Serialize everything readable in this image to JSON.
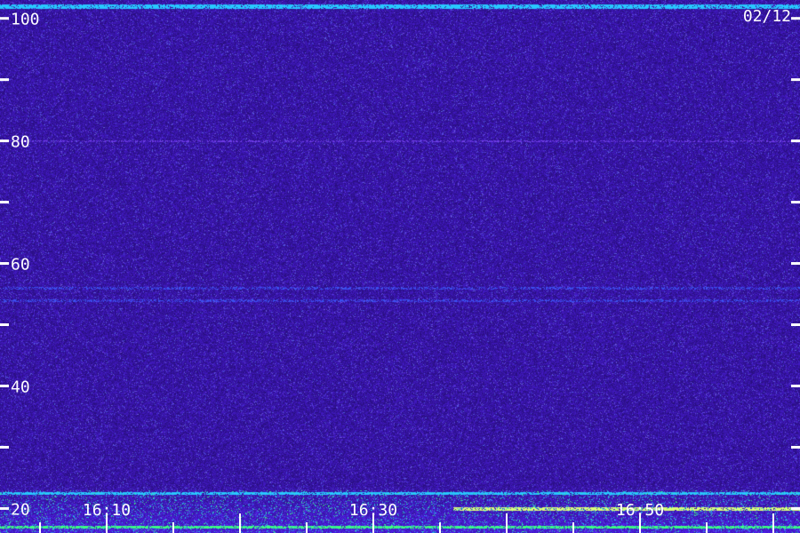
{
  "date_label": "02/12",
  "colors": {
    "background": "#1a0a5e",
    "noise_high": "#3a2ad0",
    "line_cyan": "#2ec8ff",
    "line_green": "#3cff8a",
    "line_yellow": "#e8ff7a",
    "axis": "#ffffff"
  },
  "chart_data": {
    "type": "heatmap",
    "title": "",
    "xlabel": "",
    "ylabel": "",
    "x_range": [
      "16:02",
      "17:02"
    ],
    "x_ticks": [
      "16:10",
      "16:30",
      "16:50"
    ],
    "y_range": [
      16,
      103
    ],
    "y_ticks": [
      20,
      40,
      60,
      80,
      100
    ],
    "y_minor_ticks": [
      30,
      50,
      70,
      90
    ],
    "x_minor_step_minutes": 5,
    "grid": false,
    "bands": [
      {
        "y": 102,
        "strength": "strong",
        "color": "cyan"
      },
      {
        "y": 80,
        "strength": "faint",
        "color": "violet"
      },
      {
        "y": 56,
        "strength": "faint",
        "color": "blue"
      },
      {
        "y": 54,
        "strength": "faint",
        "color": "blue"
      },
      {
        "y": 22.5,
        "strength": "medium",
        "color": "cyan"
      },
      {
        "y": 20,
        "strength": "strong",
        "color": "yellow-green",
        "x_from": "16:36",
        "x_to": "17:02"
      },
      {
        "y": 17,
        "strength": "medium",
        "color": "green"
      }
    ]
  }
}
